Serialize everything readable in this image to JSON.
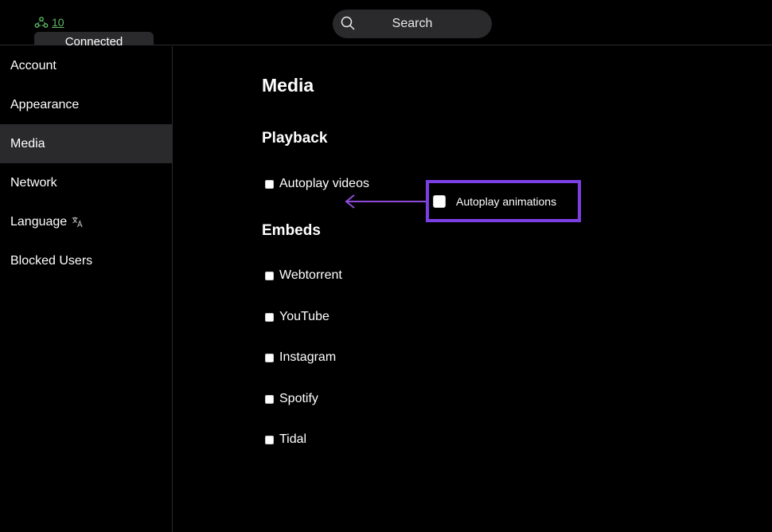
{
  "header": {
    "peer_count": "10",
    "connection_status": "Connected",
    "search_label": "Search"
  },
  "sidebar": {
    "items": [
      {
        "label": "Account"
      },
      {
        "label": "Appearance"
      },
      {
        "label": "Media",
        "active": true
      },
      {
        "label": "Network"
      },
      {
        "label": "Language",
        "icon": "translate-icon"
      },
      {
        "label": "Blocked Users"
      }
    ]
  },
  "main": {
    "title": "Media",
    "playback": {
      "heading": "Playback",
      "options": [
        {
          "label": "Autoplay videos",
          "checked": false
        }
      ]
    },
    "embeds": {
      "heading": "Embeds",
      "options": [
        {
          "label": "Webtorrent",
          "checked": false
        },
        {
          "label": "YouTube",
          "checked": false
        },
        {
          "label": "Instagram",
          "checked": false
        },
        {
          "label": "Spotify",
          "checked": false
        },
        {
          "label": "Tidal",
          "checked": false
        }
      ]
    }
  },
  "callout": {
    "label": "Autoplay animations",
    "checked": false,
    "highlight_color": "#7b3fe4",
    "arrow_color": "#8e4bd8"
  },
  "colors": {
    "background": "#000000",
    "surface": "#2a2a2d",
    "peer_green": "#5dbb63"
  }
}
